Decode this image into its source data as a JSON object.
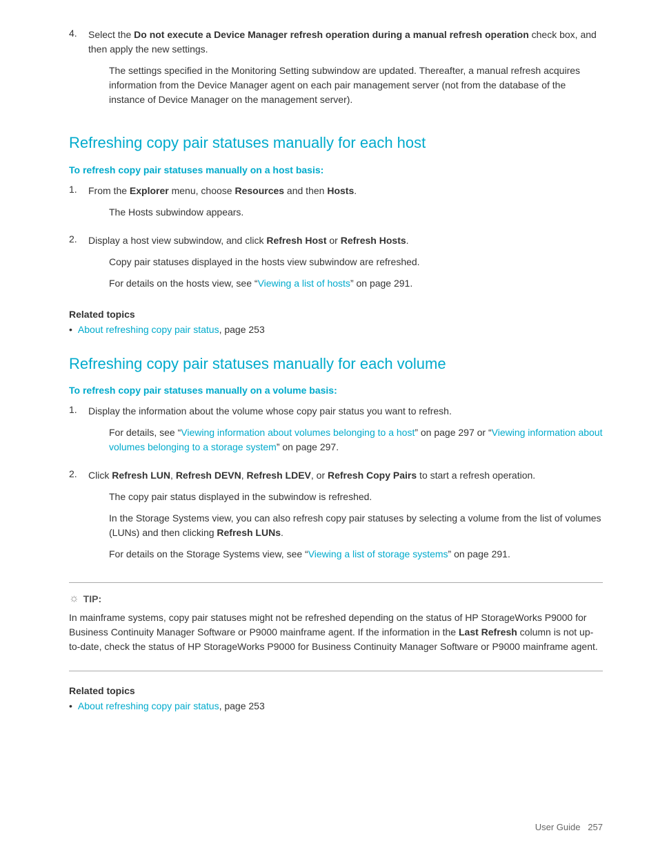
{
  "page": {
    "footer": {
      "label": "User Guide",
      "page_num": "257"
    }
  },
  "intro": {
    "step4_label": "4.",
    "step4_text_bold": "Do not execute a Device Manager refresh operation during a manual refresh operation",
    "step4_text_normal": " check box, and then apply the new settings.",
    "step4_para": "The settings specified in the Monitoring Setting subwindow are updated. Thereafter, a manual refresh acquires information from the Device Manager agent on each pair management server (not from the database of the instance of Device Manager on the management server)."
  },
  "section1": {
    "heading": "Refreshing copy pair statuses manually for each host",
    "subheading": "To refresh copy pair statuses manually on a host basis:",
    "step1_num": "1.",
    "step1_text_pre": "From the ",
    "step1_bold1": "Explorer",
    "step1_text_mid": " menu, choose ",
    "step1_bold2": "Resources",
    "step1_text_mid2": " and then ",
    "step1_bold3": "Hosts",
    "step1_text_end": ".",
    "step1_indent": "The Hosts subwindow appears.",
    "step2_num": "2.",
    "step2_text_pre": "Display a host view subwindow, and click ",
    "step2_bold1": "Refresh Host",
    "step2_text_mid": " or ",
    "step2_bold2": "Refresh Hosts",
    "step2_text_end": ".",
    "step2_indent1": "Copy pair statuses displayed in the hosts view subwindow are refreshed.",
    "step2_indent2_pre": "For details on the hosts view, see “",
    "step2_link": "Viewing a list of hosts",
    "step2_indent2_end": "” on page 291.",
    "related_topics_label": "Related topics",
    "bullet1_link": "About refreshing copy pair status",
    "bullet1_text": ", page 253"
  },
  "section2": {
    "heading": "Refreshing copy pair statuses manually for each volume",
    "subheading": "To refresh copy pair statuses manually on a volume basis:",
    "step1_num": "1.",
    "step1_text": "Display the information about the volume whose copy pair status you want to refresh.",
    "step1_indent_pre": "For details, see “",
    "step1_link1": "Viewing information about volumes belonging to a host",
    "step1_text_mid": "” on page 297 or “",
    "step1_link2": "Viewing information about volumes belonging to a storage system",
    "step1_text_end": "” on page 297.",
    "step2_num": "2.",
    "step2_text_pre": "Click ",
    "step2_bold1": "Refresh LUN",
    "step2_text2": ", ",
    "step2_bold2": "Refresh DEVN",
    "step2_text3": ", ",
    "step2_bold3": "Refresh LDEV",
    "step2_text4": ", or ",
    "step2_bold4": "Refresh Copy Pairs",
    "step2_text_end": " to start a refresh operation.",
    "step2_indent1_pre": "The copy pair status displayed in the",
    "step2_indent1_mid": "                 ",
    "step2_indent1_end": "subwindow is refreshed.",
    "step2_indent2": "In the Storage Systems view, you can also refresh copy pair statuses by selecting a volume from the list of volumes (LUNs) and then clicking ",
    "step2_bold_luns": "Refresh LUNs",
    "step2_indent2_end": ".",
    "step2_indent3_pre": "For details on the Storage Systems view, see “",
    "step2_link3": "Viewing a list of storage systems",
    "step2_indent3_end": "” on page 291.",
    "tip_label": "TIP:",
    "tip_text": "In mainframe systems, copy pair statuses might not be refreshed depending on the status of HP StorageWorks P9000 for Business Continuity Manager Software or P9000 mainframe agent. If the information in the ",
    "tip_bold": "Last Refresh",
    "tip_text2": " column is not up-to-date, check the status of HP StorageWorks P9000 for Business Continuity Manager Software or P9000 mainframe agent.",
    "related_topics_label": "Related topics",
    "bullet1_link": "About refreshing copy pair status",
    "bullet1_text": ", page 253"
  }
}
